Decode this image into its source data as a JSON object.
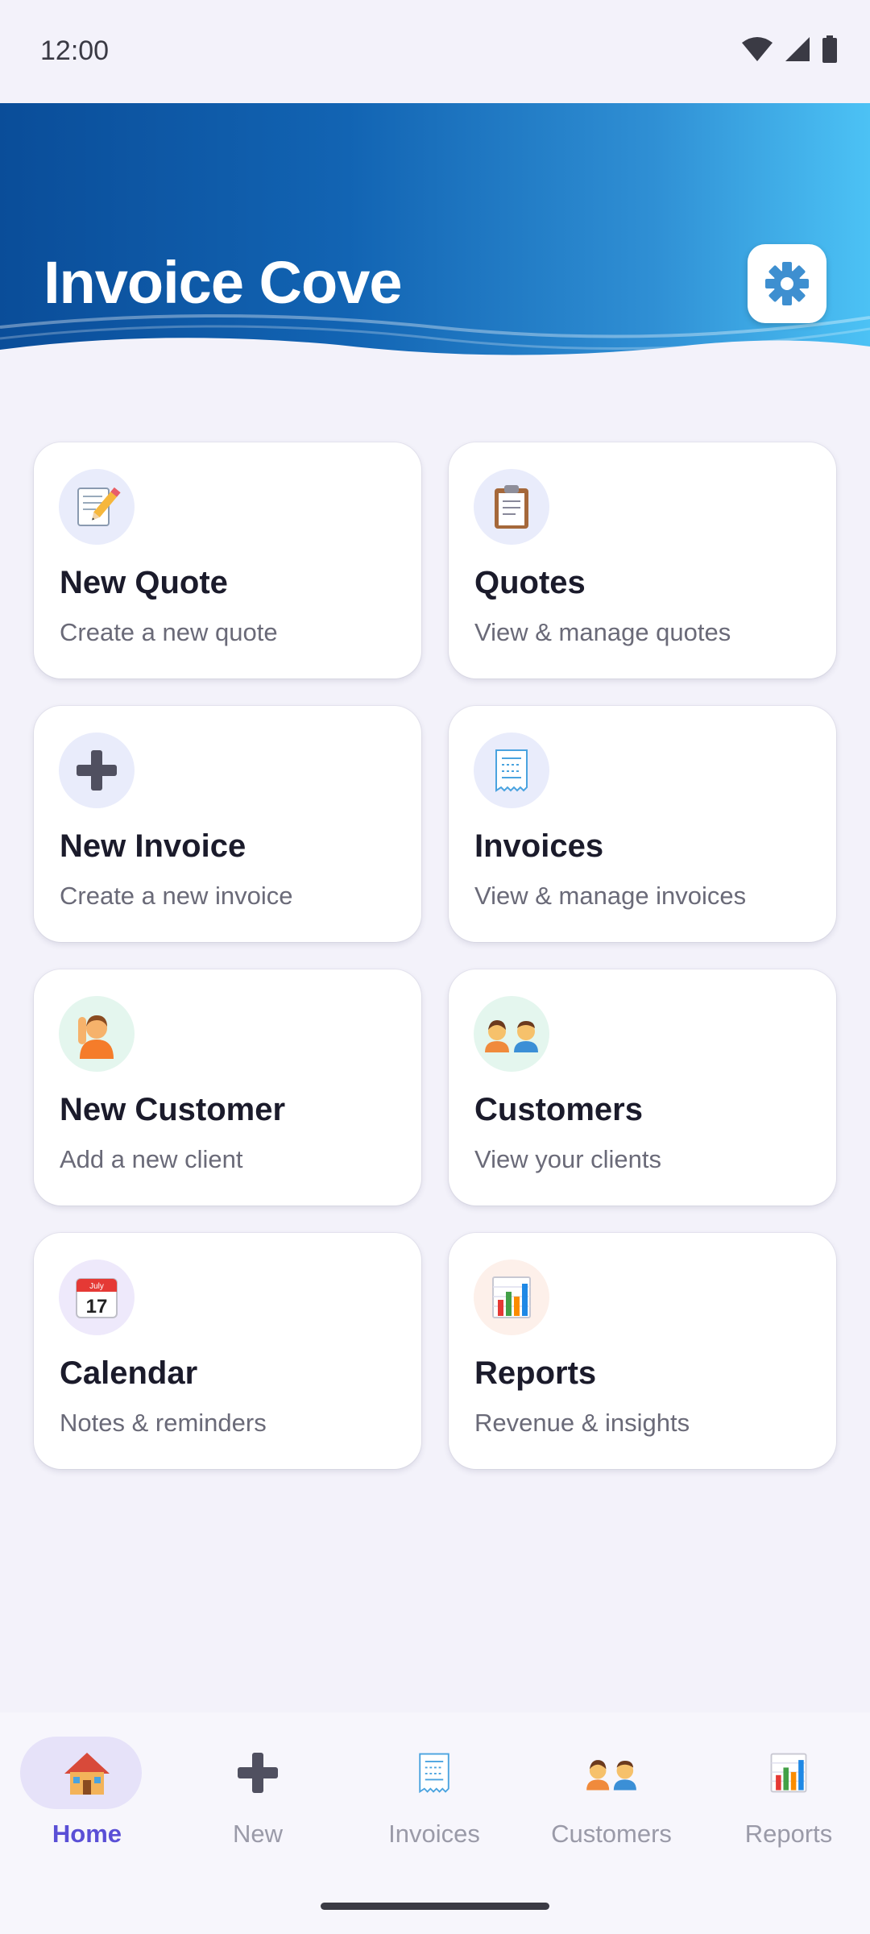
{
  "status_bar": {
    "time": "12:00"
  },
  "header": {
    "title": "Invoice Cove",
    "settings_icon": "gear-icon"
  },
  "colors": {
    "header_gradient": [
      "#0a4d99",
      "#4cc2f5"
    ],
    "accent": "#5a4fd6",
    "background": "#f3f2fa"
  },
  "cards": [
    {
      "title": "New Quote",
      "subtitle": "Create a new quote",
      "icon": "memo-pencil-icon",
      "icon_bg": "#e9ecfb"
    },
    {
      "title": "Quotes",
      "subtitle": "View & manage quotes",
      "icon": "clipboard-icon",
      "icon_bg": "#e9ecfb"
    },
    {
      "title": "New Invoice",
      "subtitle": "Create a new invoice",
      "icon": "plus-icon",
      "icon_bg": "#e9ecfb"
    },
    {
      "title": "Invoices",
      "subtitle": "View & manage invoices",
      "icon": "receipt-icon",
      "icon_bg": "#e9ecfb"
    },
    {
      "title": "New Customer",
      "subtitle": "Add a new client",
      "icon": "person-raising-hand-icon",
      "icon_bg": "#e4f6ee"
    },
    {
      "title": "Customers",
      "subtitle": "View your clients",
      "icon": "two-people-icon",
      "icon_bg": "#e4f6ee"
    },
    {
      "title": "Calendar",
      "subtitle": "Notes & reminders",
      "icon": "calendar-icon",
      "icon_bg": "#eee9fb"
    },
    {
      "title": "Reports",
      "subtitle": "Revenue & insights",
      "icon": "bar-chart-icon",
      "icon_bg": "#fdf0ea"
    }
  ],
  "calendar_icon_text": {
    "month": "July",
    "day": "17"
  },
  "bottom_nav": {
    "active": "Home",
    "items": [
      {
        "label": "Home",
        "icon": "house-icon"
      },
      {
        "label": "New",
        "icon": "plus-icon"
      },
      {
        "label": "Invoices",
        "icon": "receipt-icon"
      },
      {
        "label": "Customers",
        "icon": "two-people-icon"
      },
      {
        "label": "Reports",
        "icon": "bar-chart-icon"
      }
    ]
  }
}
